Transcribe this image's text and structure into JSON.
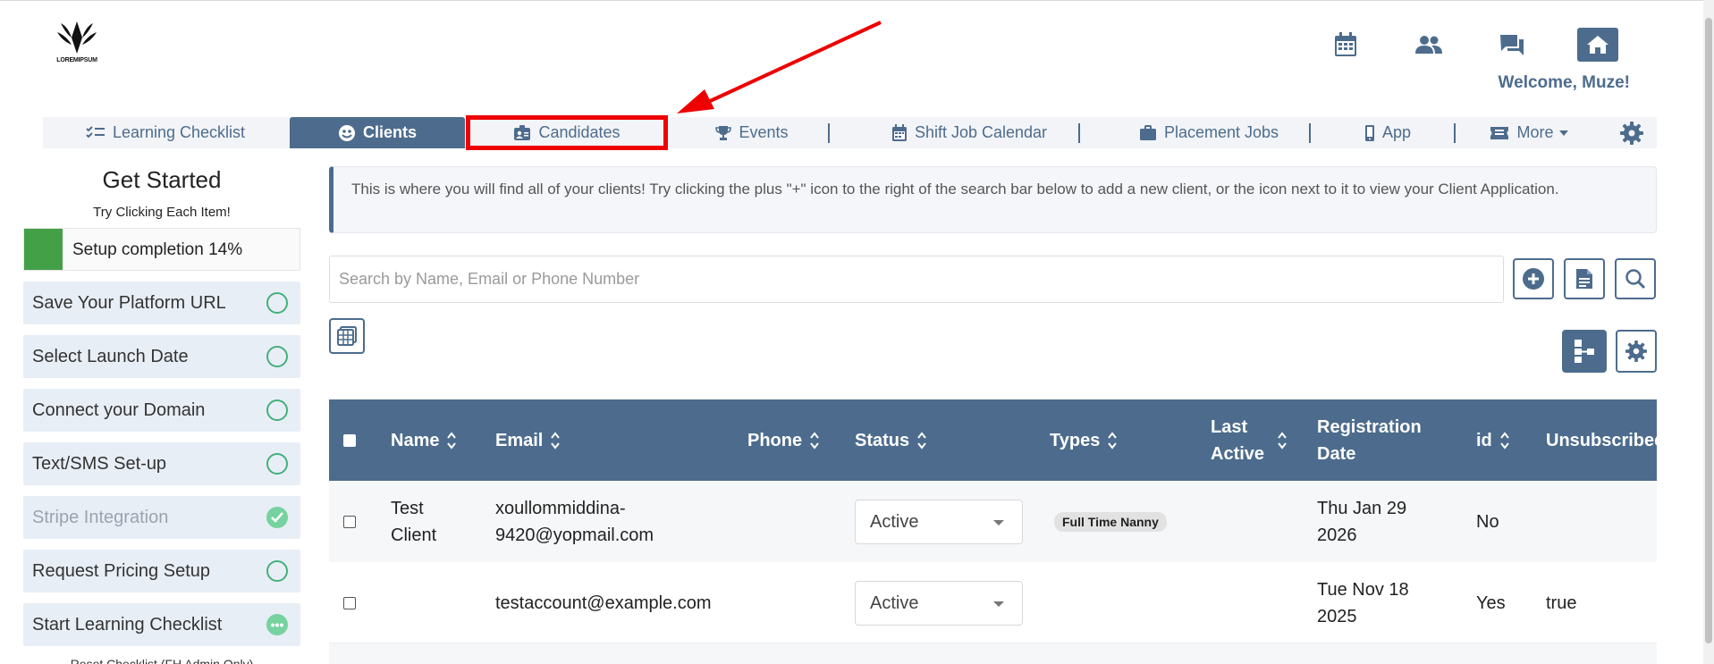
{
  "logo": {
    "text": "LOREMIPSUM"
  },
  "header": {
    "welcome": "Welcome, Muze!"
  },
  "nav": {
    "items": [
      {
        "label": "Learning Checklist"
      },
      {
        "label": "Clients"
      },
      {
        "label": "Candidates"
      },
      {
        "label": "Events"
      },
      {
        "label": "Shift Job Calendar"
      },
      {
        "label": "Placement Jobs"
      },
      {
        "label": "App"
      },
      {
        "label": "More"
      }
    ],
    "active": "Clients",
    "highlighted": "Candidates"
  },
  "sidebar": {
    "title": "Get Started",
    "subtitle": "Try Clicking Each Item!",
    "progress_label": "Setup completion 14%",
    "progress": 0.14,
    "steps": [
      {
        "label": "Save Your Platform URL",
        "state": "todo"
      },
      {
        "label": "Select Launch Date",
        "state": "todo"
      },
      {
        "label": "Connect your Domain",
        "state": "todo"
      },
      {
        "label": "Text/SMS Set-up",
        "state": "todo"
      },
      {
        "label": "Stripe Integration",
        "state": "done"
      },
      {
        "label": "Request Pricing Setup",
        "state": "todo"
      },
      {
        "label": "Start Learning Checklist",
        "state": "in-progress"
      }
    ],
    "reset_label": "Reset Checklist (FH Admin Only)"
  },
  "main": {
    "info": "This is where you will find all of your clients! Try clicking the plus \"+\" icon to the right of the search bar below to add a new client, or the icon next to it to view your Client Application.",
    "search_placeholder": "Search by Name, Email or Phone Number"
  },
  "table": {
    "columns": [
      "Name",
      "Email",
      "Phone",
      "Status",
      "Types",
      "Last Active",
      "Registration Date",
      "id",
      "Unsubscribed"
    ],
    "rows": [
      {
        "name": "Test Client",
        "email": "xoullommiddina-9420@yopmail.com",
        "phone": "",
        "status": "Active",
        "types": "Full Time Nanny",
        "last_active": "",
        "registration_date": "Thu Jan 29 2026",
        "id": "No",
        "unsubscribed": ""
      },
      {
        "name": "",
        "email": "testaccount@example.com",
        "phone": "",
        "status": "Active",
        "types": "",
        "last_active": "",
        "registration_date": "Tue Nov 18 2025",
        "id": "Yes",
        "unsubscribed": "true"
      }
    ]
  },
  "colors": {
    "primary": "#4d6c8d",
    "success": "#44a047",
    "highlight": "#ee0000"
  }
}
